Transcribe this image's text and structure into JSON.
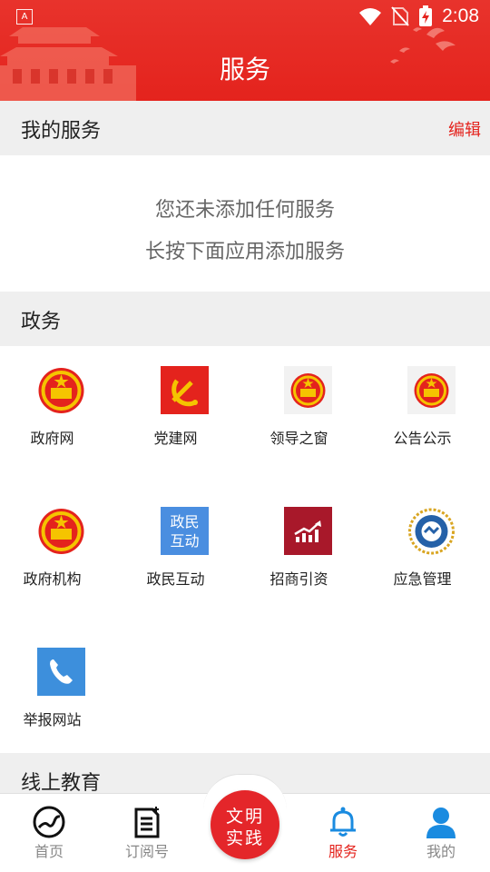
{
  "status_bar": {
    "app_icon_letter": "A",
    "time": "2:08"
  },
  "header": {
    "title": "服务"
  },
  "my_services": {
    "title": "我的服务",
    "edit_label": "编辑",
    "empty_line1": "您还未添加任何服务",
    "empty_line2": "长按下面应用添加服务"
  },
  "government": {
    "title": "政务",
    "items": [
      {
        "label": "政府网",
        "icon": "national-emblem-icon"
      },
      {
        "label": "党建网",
        "icon": "party-flag-icon"
      },
      {
        "label": "领导之窗",
        "icon": "national-emblem-icon"
      },
      {
        "label": "公告公示",
        "icon": "national-emblem-icon"
      },
      {
        "label": "政府机构",
        "icon": "national-emblem-icon"
      },
      {
        "label": "政民互动",
        "icon": "gov-people-icon",
        "icon_text1": "政民",
        "icon_text2": "互动"
      },
      {
        "label": "招商引资",
        "icon": "investment-chart-icon"
      },
      {
        "label": "应急管理",
        "icon": "emergency-badge-icon"
      },
      {
        "label": "举报网站",
        "icon": "phone-icon"
      }
    ]
  },
  "online_education": {
    "title": "线上教育"
  },
  "bottom_nav": {
    "items": [
      {
        "label": "首页",
        "icon": "home-globe-icon"
      },
      {
        "label": "订阅号",
        "icon": "subscription-icon"
      },
      {
        "label": "服务",
        "icon": "bell-icon"
      },
      {
        "label": "我的",
        "icon": "user-icon"
      }
    ],
    "center_line1": "文明",
    "center_line2": "实践"
  },
  "colors": {
    "brand_red": "#e4231d",
    "blue_accent": "#1a8be0",
    "gray_text": "#888888"
  }
}
